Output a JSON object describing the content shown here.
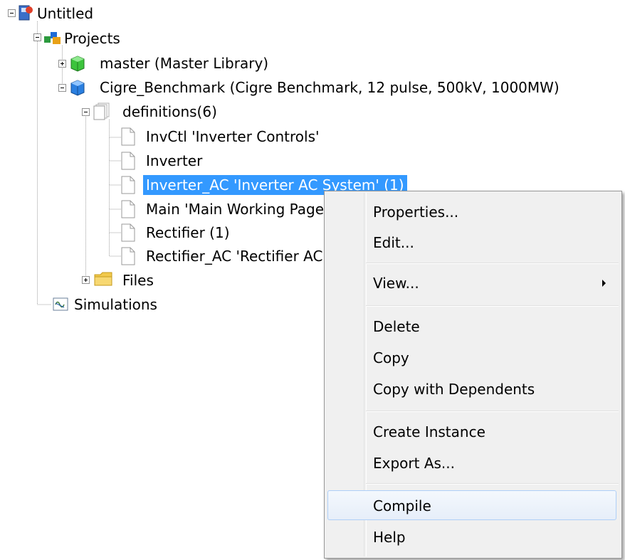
{
  "tree": {
    "root": {
      "label": "Untitled",
      "icon": "workspace-icon"
    },
    "projects": {
      "label": "Projects",
      "icon": "projects-icon"
    },
    "master": {
      "label": "master (Master Library)",
      "icon": "library-cube-green-icon"
    },
    "cigre": {
      "label": "Cigre_Benchmark (Cigre Benchmark, 12 pulse, 500kV, 1000MW)",
      "icon": "project-cube-blue-icon"
    },
    "definitions": {
      "label": "definitions(6)",
      "icon": "document-stack-icon"
    },
    "items": [
      {
        "label": "InvCtl 'Inverter Controls'"
      },
      {
        "label": "Inverter"
      },
      {
        "label": "Inverter_AC 'Inverter AC System' (1)",
        "selected": true
      },
      {
        "label": "Main 'Main Working Page'"
      },
      {
        "label": "Rectifier (1)"
      },
      {
        "label": "Rectifier_AC 'Rectifier AC System'"
      }
    ],
    "files": {
      "label": "Files",
      "icon": "folder-icon"
    },
    "simulations": {
      "label": "Simulations",
      "icon": "simulation-icon"
    }
  },
  "context_menu": {
    "properties": "Properties...",
    "edit": "Edit...",
    "view": "View...",
    "delete": "Delete",
    "copy": "Copy",
    "copy_with_dependents": "Copy with Dependents",
    "create_instance": "Create Instance",
    "export_as": "Export As...",
    "compile": "Compile",
    "help": "Help",
    "highlighted": "Compile"
  },
  "colors": {
    "selection": "#3399ff",
    "menu_background": "#f0f0f0",
    "menu_highlight_border": "#aecff7"
  }
}
